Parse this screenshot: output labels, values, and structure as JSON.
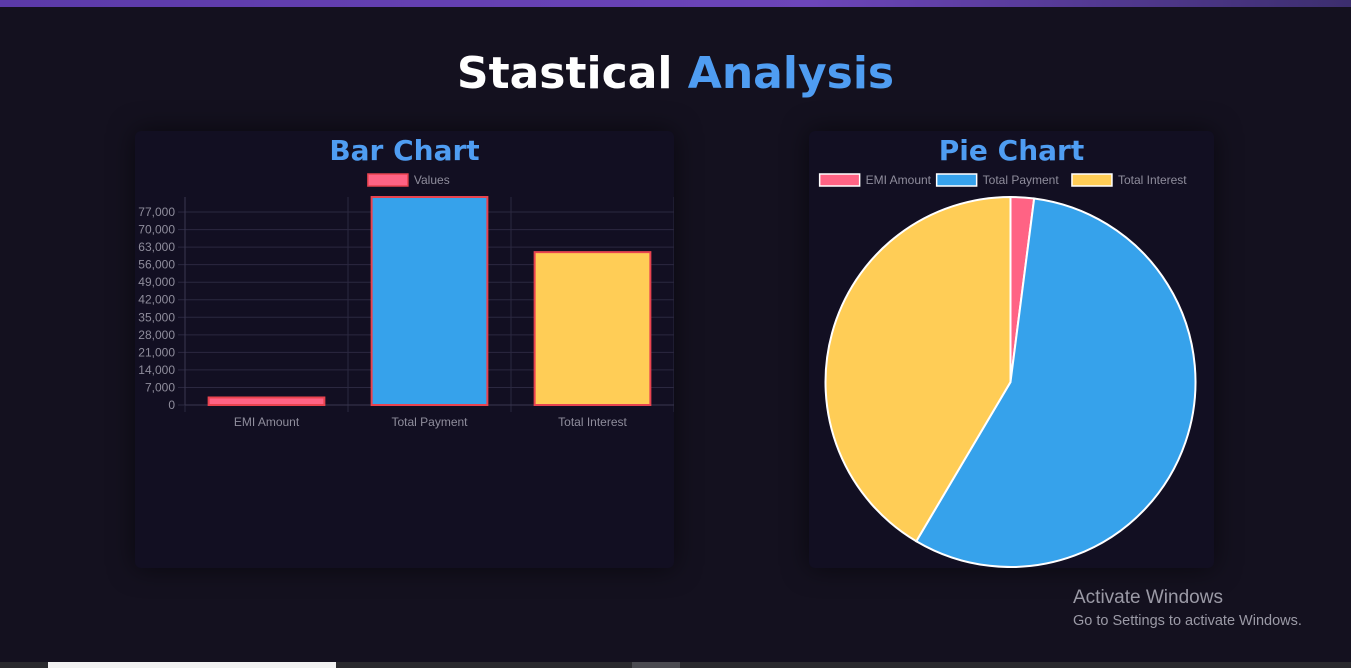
{
  "page": {
    "title_part1": "Stastical",
    "title_part2": "Analysis"
  },
  "colors": {
    "emi": "#ff6384",
    "payment": "#36a2eb",
    "interest": "#ffcd56",
    "bar_border": "#e8434f",
    "title_accent": "#4f9df2",
    "background": "#14111f",
    "card_bg": "#120f22"
  },
  "chart_data": [
    {
      "type": "bar",
      "title": "Bar Chart",
      "legend": [
        "Values"
      ],
      "legend_position": "top",
      "categories": [
        "EMI Amount",
        "Total Payment",
        "Total Interest"
      ],
      "series": [
        {
          "name": "Values",
          "values": [
            3000,
            83000,
            61000
          ]
        }
      ],
      "ylim": [
        0,
        83000
      ],
      "yticks": [
        0,
        7000,
        14000,
        21000,
        28000,
        35000,
        42000,
        49000,
        56000,
        63000,
        70000,
        77000
      ],
      "ytick_labels": [
        "0",
        "7,000",
        "14,000",
        "21,000",
        "28,000",
        "35,000",
        "42,000",
        "49,000",
        "56,000",
        "63,000",
        "70,000",
        "77,000"
      ],
      "grid": true
    },
    {
      "type": "pie",
      "title": "Pie Chart",
      "legend": [
        "EMI Amount",
        "Total Payment",
        "Total Interest"
      ],
      "legend_position": "top",
      "values": [
        3000,
        83000,
        61000
      ]
    }
  ],
  "watermark": {
    "line1": "Activate Windows",
    "line2": "Go to Settings to activate Windows."
  }
}
